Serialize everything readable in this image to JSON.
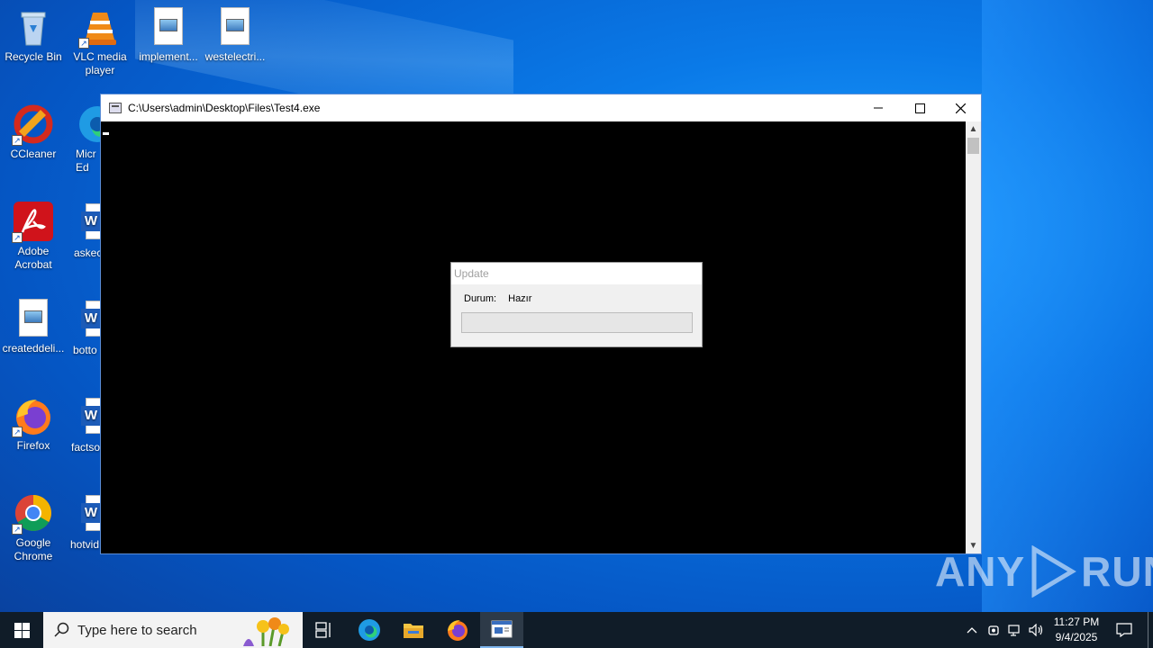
{
  "desktop": {
    "icons": [
      {
        "label": "Recycle Bin"
      },
      {
        "label": "VLC media player"
      },
      {
        "label": "implement..."
      },
      {
        "label": "westelectri..."
      },
      {
        "label": "CCleaner"
      },
      {
        "label": "Micr Ed"
      },
      {
        "label": "Adobe Acrobat"
      },
      {
        "label": "askec"
      },
      {
        "label": "createddeli..."
      },
      {
        "label": "botto"
      },
      {
        "label": "Firefox"
      },
      {
        "label": "factso"
      },
      {
        "label": "Google Chrome"
      },
      {
        "label": "hotvid"
      }
    ]
  },
  "console": {
    "title": "C:\\Users\\admin\\Desktop\\Files\\Test4.exe",
    "minimize_icon": "minimize-icon",
    "maximize_icon": "maximize-icon",
    "close_icon": "close-icon"
  },
  "update_dialog": {
    "title": "Update",
    "status_label": "Durum:",
    "status_value": "Hazır",
    "progress": 0
  },
  "watermark": {
    "left": "ANY",
    "right": "RUN"
  },
  "taskbar": {
    "search_placeholder": "Type here to search",
    "time": "11:27 PM",
    "date": "9/4/2025"
  },
  "colors": {
    "taskbar_bg": "#101c28",
    "console_bg": "#000000",
    "dialog_bg": "#f0f0f0",
    "desktop_accent": "#0a7ae8"
  }
}
